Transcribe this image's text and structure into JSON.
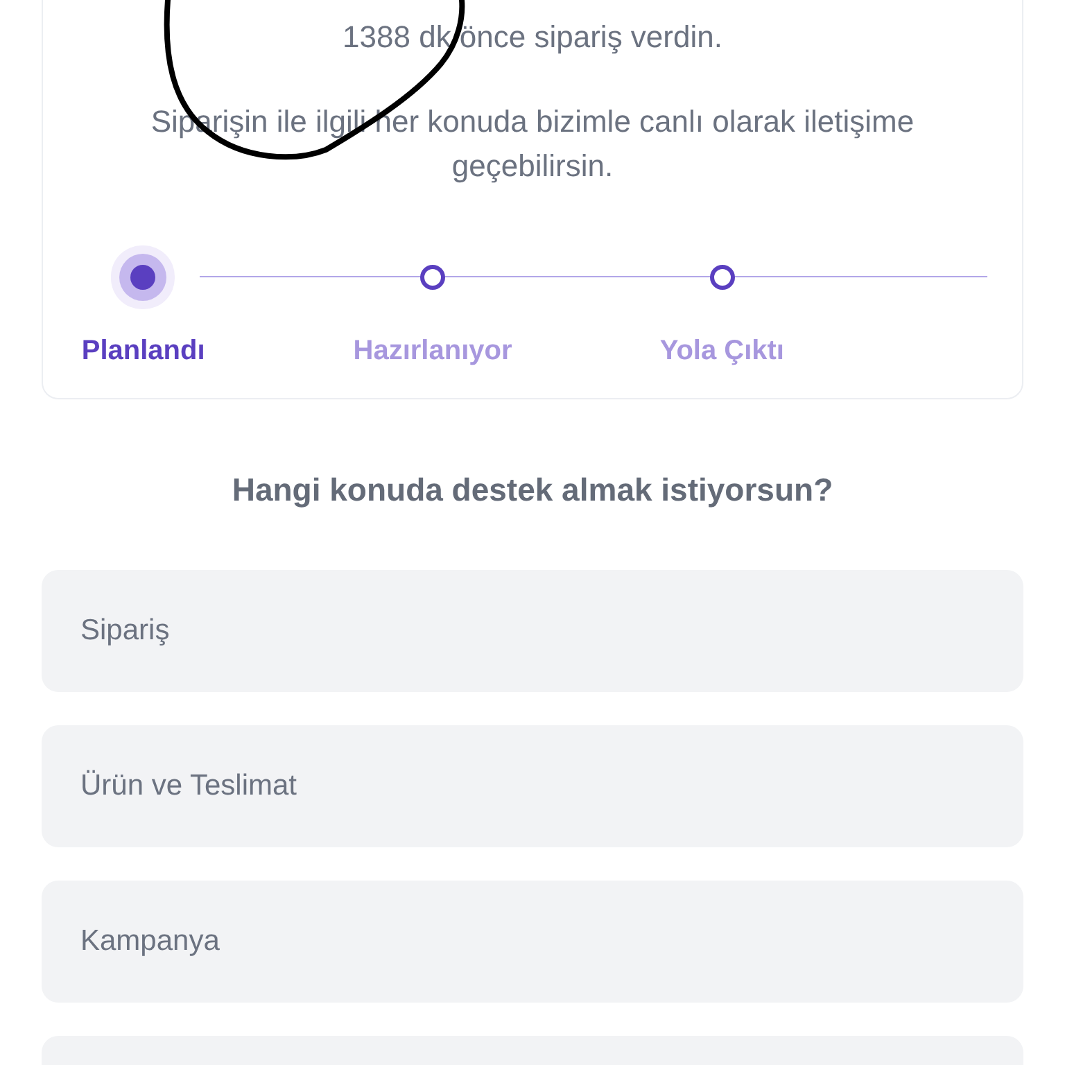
{
  "order_card": {
    "ordered_ago": "1388 dk önce sipariş verdin.",
    "contact_note": "Siparişin ile ilgili her konuda bizimle canlı olarak iletişime geçebilirsin.",
    "steps": [
      {
        "label": "Planlandı",
        "selected": true
      },
      {
        "label": "Hazırlanıyor",
        "selected": false
      },
      {
        "label": "Yola Çıktı",
        "selected": false
      }
    ]
  },
  "support": {
    "question": "Hangi konuda destek almak istiyorsun?",
    "topics": [
      {
        "label": "Sipariş"
      },
      {
        "label": "Ürün ve Teslimat"
      },
      {
        "label": "Kampanya"
      }
    ]
  }
}
